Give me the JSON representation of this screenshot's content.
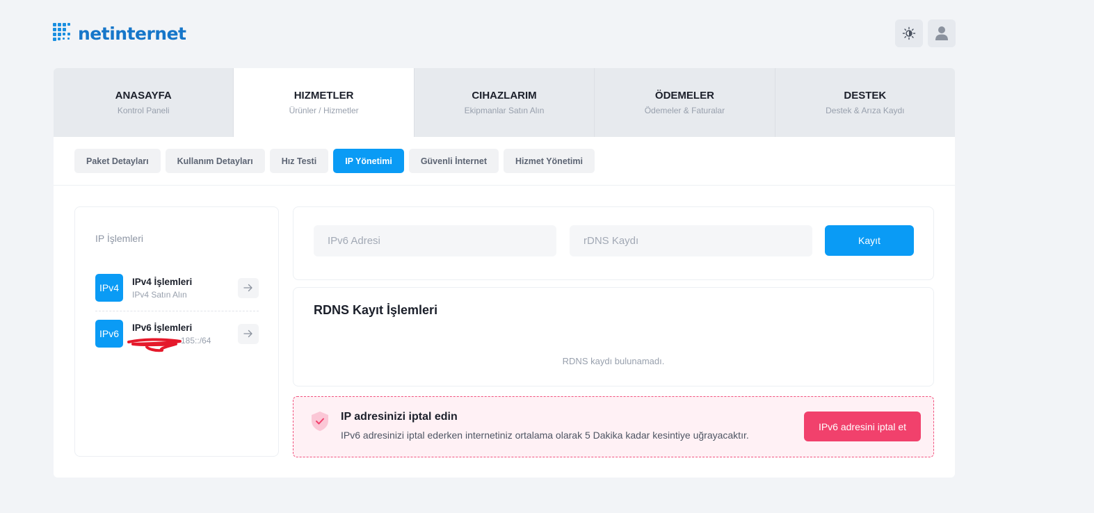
{
  "brand": {
    "name": "netinternet",
    "color": "#1676c9"
  },
  "header": {
    "theme_icon": "sun-icon",
    "user_icon": "user-icon"
  },
  "nav": [
    {
      "title": "ANASAYFA",
      "subtitle": "Kontrol Paneli",
      "active": false
    },
    {
      "title": "HIZMETLER",
      "subtitle": "Ürünler / Hizmetler",
      "active": true
    },
    {
      "title": "CIHAZLARIM",
      "subtitle": "Ekipmanlar Satın Alın",
      "active": false
    },
    {
      "title": "ÖDEMELER",
      "subtitle": "Ödemeler & Faturalar",
      "active": false
    },
    {
      "title": "DESTEK",
      "subtitle": "Destek & Arıza Kaydı",
      "active": false
    }
  ],
  "subtabs": [
    {
      "label": "Paket Detayları",
      "active": false
    },
    {
      "label": "Kullanım Detayları",
      "active": false
    },
    {
      "label": "Hız Testi",
      "active": false
    },
    {
      "label": "IP Yönetimi",
      "active": true
    },
    {
      "label": "Güvenli İnternet",
      "active": false
    },
    {
      "label": "Hizmet Yönetimi",
      "active": false
    }
  ],
  "sidebar": {
    "title": "IP İşlemleri",
    "items": [
      {
        "badge": "IPv4",
        "name": "IPv4 İşlemleri",
        "desc": "IPv4 Satın Alın"
      },
      {
        "badge": "IPv6",
        "name": "IPv6 İşlemleri",
        "desc": "185::/64"
      }
    ]
  },
  "form": {
    "ipv6_placeholder": "IPv6 Adresi",
    "rdns_placeholder": "rDNS Kaydı",
    "save_label": "Kayıt"
  },
  "rdns": {
    "title": "RDNS Kayıt İşlemleri",
    "empty": "RDNS kaydı bulunamadı."
  },
  "warning": {
    "title": "IP adresinizi iptal edin",
    "desc": "IPv6 adresinizi iptal ederken internetiniz ortalama olarak 5 Dakika kadar kesintiye uğrayacaktır.",
    "button": "IPv6 adresini iptal et"
  },
  "colors": {
    "primary": "#0a9bf5",
    "danger": "#f1416c",
    "warning_bg": "#fff1f5"
  }
}
